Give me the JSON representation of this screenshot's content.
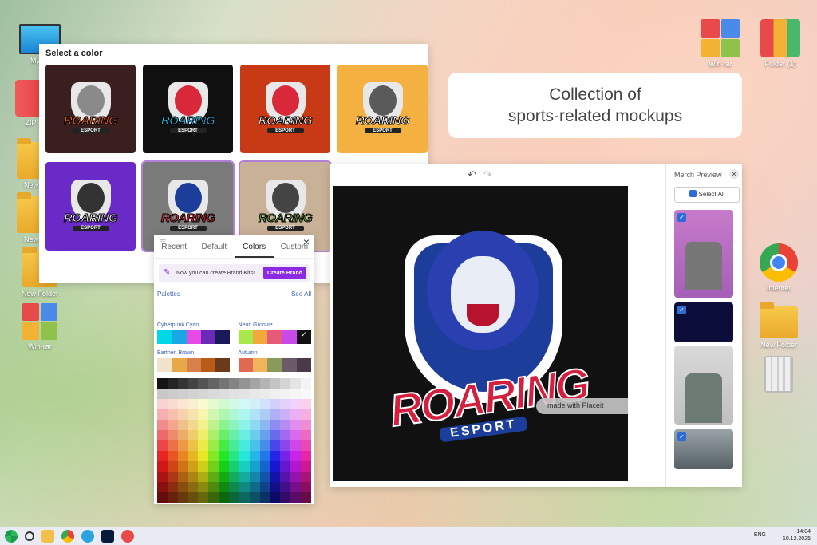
{
  "desktop": {
    "icons": [
      {
        "label": "My co"
      },
      {
        "label": "ZIP -"
      },
      {
        "label": "New F"
      },
      {
        "label": "New F"
      },
      {
        "label": "New Folder"
      },
      {
        "label": "Win-rar"
      },
      {
        "label": "Win-rar"
      },
      {
        "label": "Folder (1)"
      },
      {
        "label": "Internet"
      },
      {
        "label": "New Folder"
      }
    ]
  },
  "selector": {
    "title": "Select a color",
    "logo_word": "ROARING",
    "logo_sub": "ESPORT"
  },
  "headline": {
    "line1": "Collection of",
    "line2": "sports-related mockups"
  },
  "editor": {
    "undo": "↶",
    "redo": "↷",
    "logo_word": "ROARING",
    "logo_sub": "ESPORT",
    "watermark": "made with Placeit",
    "canvas_label": "Placeit"
  },
  "merch": {
    "title": "Merch Preview",
    "close": "×",
    "select_all": "Select All",
    "check": "✓"
  },
  "popup": {
    "tabs": [
      "Recent",
      "Default",
      "Colors",
      "Custom"
    ],
    "brand_text": "Now you can create Brand Kits!",
    "brand_button": "Create Brand",
    "palettes_title": "Palettes",
    "see_all": "See All",
    "palettes": [
      {
        "name": "Cyberpunk Cyan"
      },
      {
        "name": "Neon Groovie"
      },
      {
        "name": "Earthen Brown"
      },
      {
        "name": "Autumn"
      }
    ],
    "close": "×"
  },
  "taskbar": {
    "lang": "ENG",
    "time": "14:04",
    "date": "10.12.2025"
  },
  "colors": {
    "accent": "#8a2be2",
    "link": "#3a5fb5",
    "check": "#2f6bd6"
  }
}
